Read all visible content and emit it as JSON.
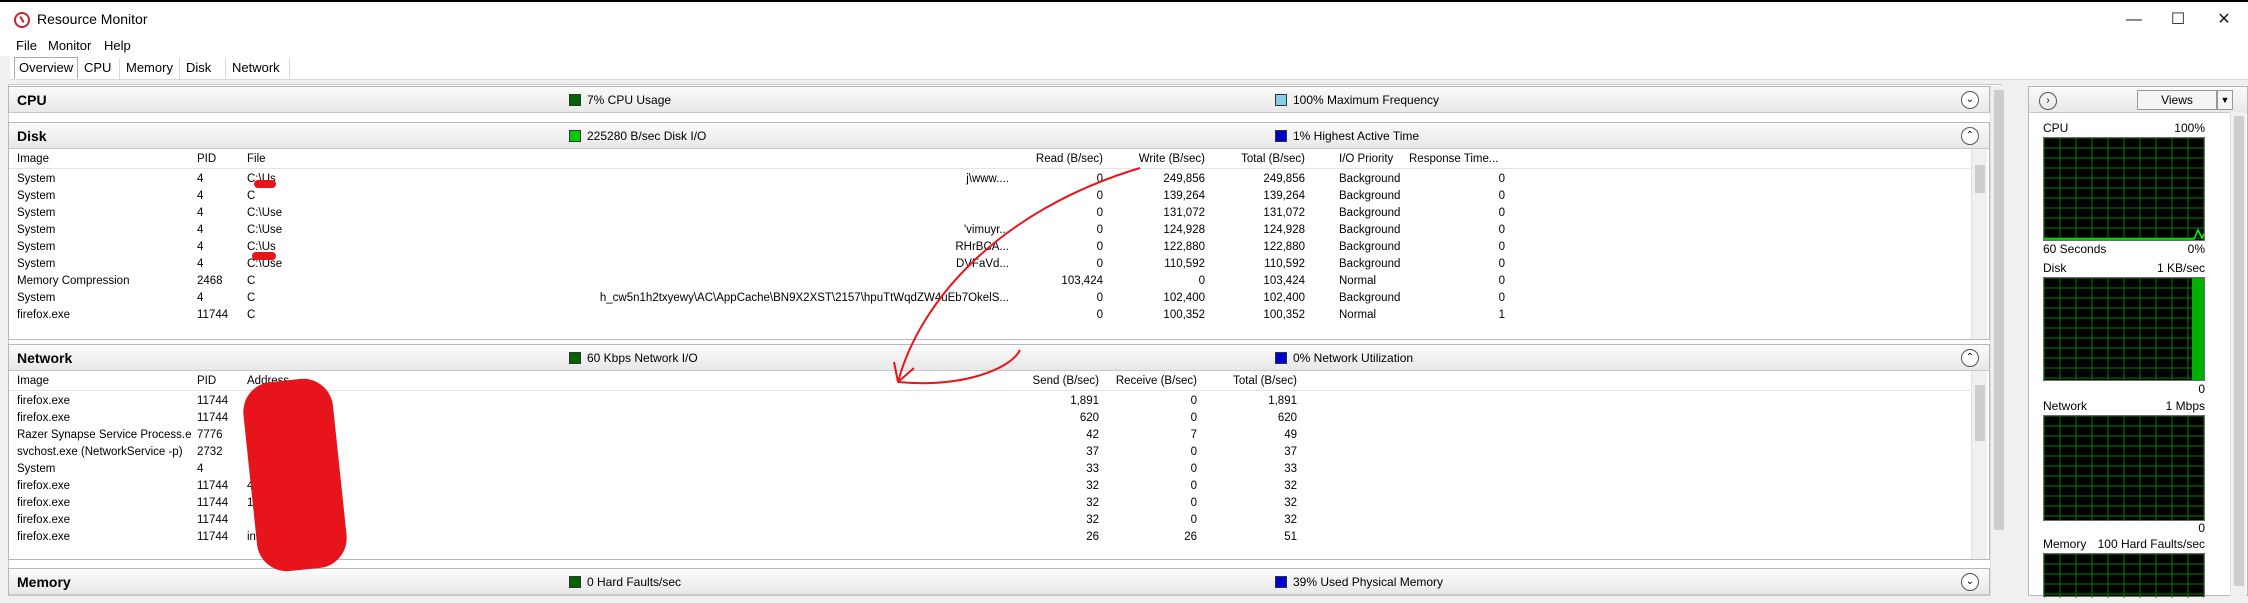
{
  "window": {
    "title": "Resource Monitor"
  },
  "menu": [
    "File",
    "Monitor",
    "Help"
  ],
  "tabs": [
    "Overview",
    "CPU",
    "Memory",
    "Disk",
    "Network"
  ],
  "cpu": {
    "title": "CPU",
    "ind1": "7% CPU Usage",
    "ind1_color": "#006400",
    "ind2": "100% Maximum Frequency",
    "ind2_color": "#87ceeb"
  },
  "disk": {
    "title": "Disk",
    "ind1": "225280 B/sec Disk I/O",
    "ind1_color": "#00cc00",
    "ind2": "1% Highest Active Time",
    "ind2_color": "#0000cc",
    "columns": [
      "Image",
      "PID",
      "File",
      "Read (B/sec)",
      "Write (B/sec)",
      "Total (B/sec)",
      "I/O Priority",
      "Response Time..."
    ],
    "rows": [
      [
        "System",
        "4",
        "C:\\Us",
        "j\\www....",
        "0",
        "249,856",
        "249,856",
        "Background",
        "0"
      ],
      [
        "System",
        "4",
        "C",
        "",
        "0",
        "139,264",
        "139,264",
        "Background",
        "0"
      ],
      [
        "System",
        "4",
        "C:\\Use",
        "",
        "0",
        "131,072",
        "131,072",
        "Background",
        "0"
      ],
      [
        "System",
        "4",
        "C:\\Use",
        "'vimuyr...",
        "0",
        "124,928",
        "124,928",
        "Background",
        "0"
      ],
      [
        "System",
        "4",
        "C:\\Us",
        "RHrBCA...",
        "0",
        "122,880",
        "122,880",
        "Background",
        "0"
      ],
      [
        "System",
        "4",
        "C:\\Use",
        "DVFaVd...",
        "0",
        "110,592",
        "110,592",
        "Background",
        "0"
      ],
      [
        "Memory Compression",
        "2468",
        "C",
        "",
        "103,424",
        "0",
        "103,424",
        "Normal",
        "0"
      ],
      [
        "System",
        "4",
        "C",
        "h_cw5n1h2txyewy\\AC\\AppCache\\BN9X2XST\\2157\\hpuTtWqdZW4uEb7OkelS...",
        "0",
        "102,400",
        "102,400",
        "Background",
        "0"
      ],
      [
        "firefox.exe",
        "11744",
        "C",
        "",
        "0",
        "100,352",
        "100,352",
        "Normal",
        "1"
      ]
    ]
  },
  "network": {
    "title": "Network",
    "ind1": "60 Kbps Network I/O",
    "ind1_color": "#006400",
    "ind2": "0% Network Utilization",
    "ind2_color": "#0000cc",
    "columns": [
      "Image",
      "PID",
      "Address",
      "Send (B/sec)",
      "Receive (B/sec)",
      "Total (B/sec)"
    ],
    "rows": [
      [
        "firefox.exe",
        "11744",
        "118",
        "1,891",
        "0",
        "1,891"
      ],
      [
        "firefox.exe",
        "11744",
        "",
        "620",
        "0",
        "620"
      ],
      [
        "Razer Synapse Service Process.e...",
        "7776",
        "::1",
        "42",
        "7",
        "49"
      ],
      [
        "svchost.exe (NetworkService -p)",
        "2732",
        "fe8",
        "37",
        "0",
        "37"
      ],
      [
        "System",
        "4",
        "",
        "33",
        "0",
        "33"
      ],
      [
        "firefox.exe",
        "11744",
        "42",
        "32",
        "0",
        "32"
      ],
      [
        "firefox.exe",
        "11744",
        "172.   78",
        "32",
        "0",
        "32"
      ],
      [
        "firefox.exe",
        "11744",
        "",
        "32",
        "0",
        "32"
      ],
      [
        "firefox.exe",
        "11744",
        "ins     n",
        "26",
        "26",
        "51"
      ]
    ]
  },
  "memory": {
    "title": "Memory",
    "ind1": "0 Hard Faults/sec",
    "ind1_color": "#006400",
    "ind2": "39% Used Physical Memory",
    "ind2_color": "#0000cc"
  },
  "right_pane": {
    "views_label": "Views",
    "cpu": {
      "label": "CPU",
      "max": "100%",
      "span": "60 Seconds",
      "min": "0%"
    },
    "disk": {
      "label": "Disk",
      "max": "1 KB/sec",
      "min": "0"
    },
    "network": {
      "label": "Network",
      "max": "1 Mbps",
      "min": "0"
    },
    "memory": {
      "label": "Memory",
      "max": "100 Hard Faults/sec"
    }
  },
  "colors": {
    "graph_bg": "#000000",
    "graph_grid": "#008000",
    "graph_line": "#00ff00",
    "selected_row": "#cce8ff",
    "hover_row": "#e5f3ff",
    "annotation": "#e8141c"
  }
}
